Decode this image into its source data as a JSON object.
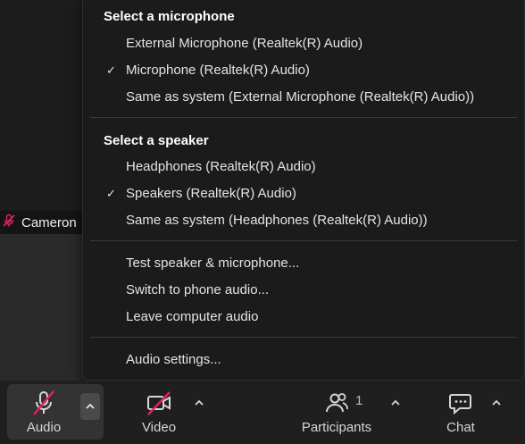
{
  "participant": {
    "name": "Cameron"
  },
  "menu": {
    "microphone_heading": "Select a microphone",
    "microphones": [
      {
        "label": "External Microphone (Realtek(R) Audio)",
        "checked": false
      },
      {
        "label": "Microphone (Realtek(R) Audio)",
        "checked": true
      },
      {
        "label": "Same as system (External Microphone (Realtek(R) Audio))",
        "checked": false
      }
    ],
    "speaker_heading": "Select a speaker",
    "speakers": [
      {
        "label": "Headphones (Realtek(R) Audio)",
        "checked": false
      },
      {
        "label": "Speakers (Realtek(R) Audio)",
        "checked": true
      },
      {
        "label": "Same as system (Headphones (Realtek(R) Audio))",
        "checked": false
      }
    ],
    "actions": [
      "Test speaker & microphone...",
      "Switch to phone audio...",
      "Leave computer audio"
    ],
    "settings": "Audio settings...",
    "check_glyph": "✓"
  },
  "toolbar": {
    "audio_label": "Audio",
    "video_label": "Video",
    "participants_label": "Participants",
    "participants_count": "1",
    "chat_label": "Chat"
  },
  "colors": {
    "muted_slash": "#e0245e",
    "menu_bg": "#1b1b1b",
    "toolbar_bg": "#1f1f1f"
  }
}
